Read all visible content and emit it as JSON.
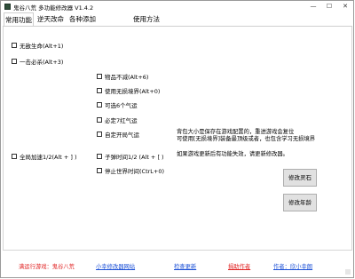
{
  "window": {
    "title": "鬼谷八荒 多功能修改器 V1.4.2",
    "minimize": "—",
    "maximize": "☐",
    "close": "✕"
  },
  "tabs": [
    "常用功能",
    "逆天改命",
    "各种添加",
    "使用方法"
  ],
  "options": {
    "wudi": "无敌生命(Alt+1)",
    "yijibisha": "一击必杀(Alt+3)",
    "wupin": "物品不减(Alt+6)",
    "jingjie": "使用无损境界(Alt+0)",
    "qiyun6": "可选6个气运",
    "qiyun7": "必定7红气运",
    "zidingqiyun": "自定开局气运",
    "quanjujiasu": "全局加速1/2(Alt + ] )",
    "zidanshijian": "子弹时间1/2 (Alt + [ )",
    "tingzhi": "停止世界时间(CtrL+0)"
  },
  "notes": {
    "line1": "背包大小是保存在游戏配置的，重进游戏会复位",
    "line2": "可使用[无损境界]装备最顶级或者，也包含学习无损境界",
    "line3": "如果游戏更新后有功能失效，请更新修改器。"
  },
  "buttons": {
    "lingshi": "修改灵石",
    "nianling": "修改年龄"
  },
  "footer": {
    "game": "满运行游戏：鬼谷八荒",
    "website": "小幸修改器网站",
    "update": "检查更新",
    "donate": "捐助作者",
    "author": "作者：欣小幸朗"
  },
  "colors": {
    "footer_red": "#e02020",
    "footer_blue": "#1a4fd6"
  }
}
